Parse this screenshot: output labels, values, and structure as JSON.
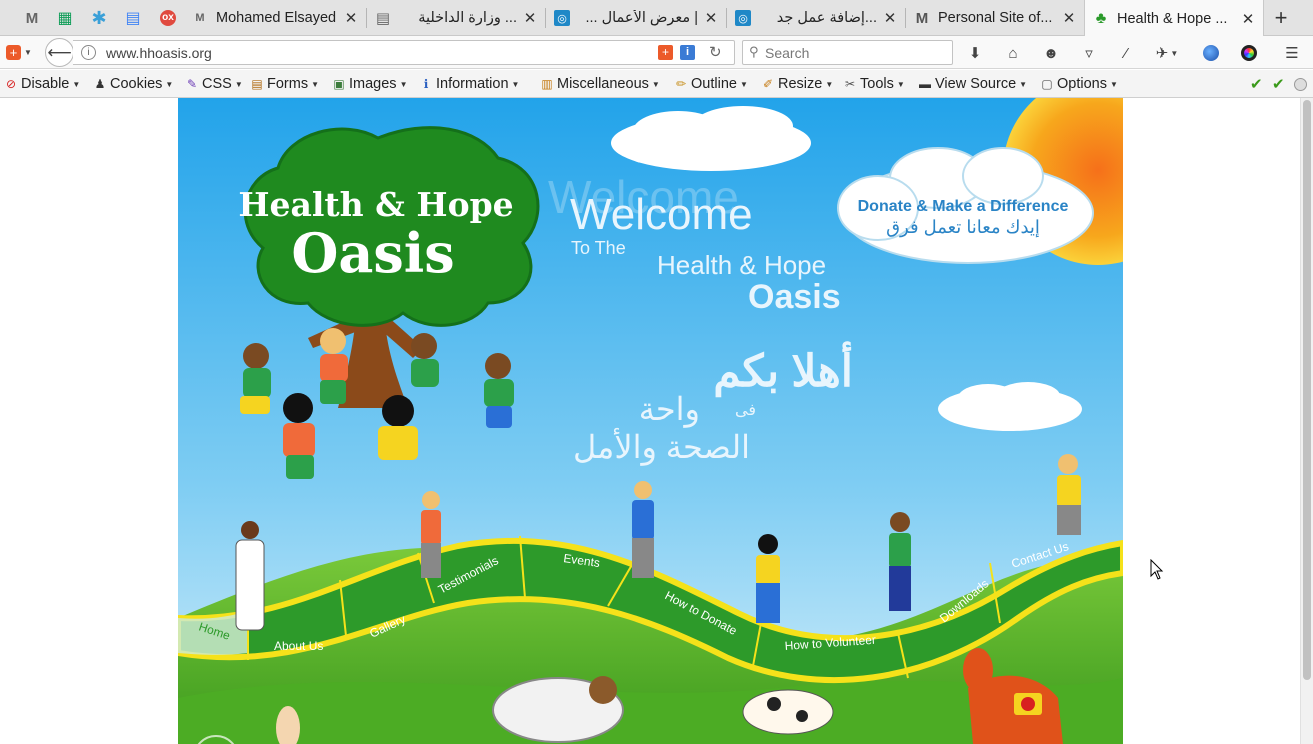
{
  "tabs": [
    {
      "title": "Mohamed Elsayed ...",
      "fav": "M",
      "favColor": "#ea4335"
    },
    {
      "title": "... وزارة الداخلية",
      "fav": "▤",
      "favColor": "#666666"
    },
    {
      "title": "| معرض الأعمال ...",
      "fav": "◎",
      "favColor": "#1f88c7"
    },
    {
      "title": "...إضافة عمل جد",
      "fav": "◎",
      "favColor": "#1f88c7"
    },
    {
      "title": "Personal Site of...",
      "fav": "M",
      "favColor": "#555555"
    },
    {
      "title": "Health & Hope ...",
      "fav": "♣",
      "favColor": "#2a9a2a",
      "active": true
    }
  ],
  "pinned": [
    {
      "name": "gmail",
      "glyph": "M",
      "color": "#666"
    },
    {
      "name": "sheets",
      "glyph": "▦",
      "color": "#0f9d58"
    },
    {
      "name": "asterisk",
      "glyph": "✱",
      "color": "#3aa0d8"
    },
    {
      "name": "docs",
      "glyph": "▤",
      "color": "#4285f4"
    },
    {
      "name": "odoo",
      "glyph": "o",
      "color": "#e04a3f"
    }
  ],
  "nav": {
    "url": "www.hhoasis.org",
    "search_placeholder": "Search"
  },
  "devbar": [
    {
      "label": "Disable",
      "icon": "⊘",
      "iconColor": "#d62020"
    },
    {
      "label": "Cookies",
      "icon": "♟",
      "iconColor": "#333"
    },
    {
      "label": "CSS",
      "icon": "✎",
      "iconColor": "#6a3ab5"
    },
    {
      "label": "Forms",
      "icon": "▤",
      "iconColor": "#b06a12"
    },
    {
      "label": "Images",
      "icon": "▣",
      "iconColor": "#3c7d3c"
    },
    {
      "label": "Information",
      "icon": "ℹ",
      "iconColor": "#2a5fc0"
    },
    {
      "label": "Miscellaneous",
      "icon": "▥",
      "iconColor": "#c47a12"
    },
    {
      "label": "Outline",
      "icon": "✏",
      "iconColor": "#c48a12"
    },
    {
      "label": "Resize",
      "icon": "✐",
      "iconColor": "#c47a12"
    },
    {
      "label": "Tools",
      "icon": "✂",
      "iconColor": "#555"
    },
    {
      "label": "View Source",
      "icon": "▬",
      "iconColor": "#333"
    },
    {
      "label": "Options",
      "icon": "▢",
      "iconColor": "#555"
    }
  ],
  "site": {
    "logo_line1": "Health & Hope",
    "logo_line2": "Oasis",
    "welcome": "Welcome",
    "welcome_shadow": "Welcome",
    "to_the": "To The",
    "hh": "Health & Hope",
    "oasis": "Oasis",
    "ar_welcome": "أهلا بكم",
    "ar_fi": "فى",
    "ar_oasis1": "واحة",
    "ar_oasis2": "الصحة والأمل",
    "donate_en": "Donate & Make a Difference",
    "donate_ar": "إيدك معانا تعمل فرق",
    "menu": [
      "Home",
      "About Us",
      "Gallery",
      "Testimonials",
      "Events",
      "How to Donate",
      "How to Volunteer",
      "Downloads",
      "Contact Us"
    ]
  },
  "colors": {
    "sky_top": "#29a8ec",
    "sky_bottom": "#bfe6f6",
    "grass": "#5aba2a",
    "menu_band": "#2d9a2a",
    "menu_yellow": "#f5e21a",
    "tree": "#1f8a1f",
    "sun": "#f7a41a"
  }
}
